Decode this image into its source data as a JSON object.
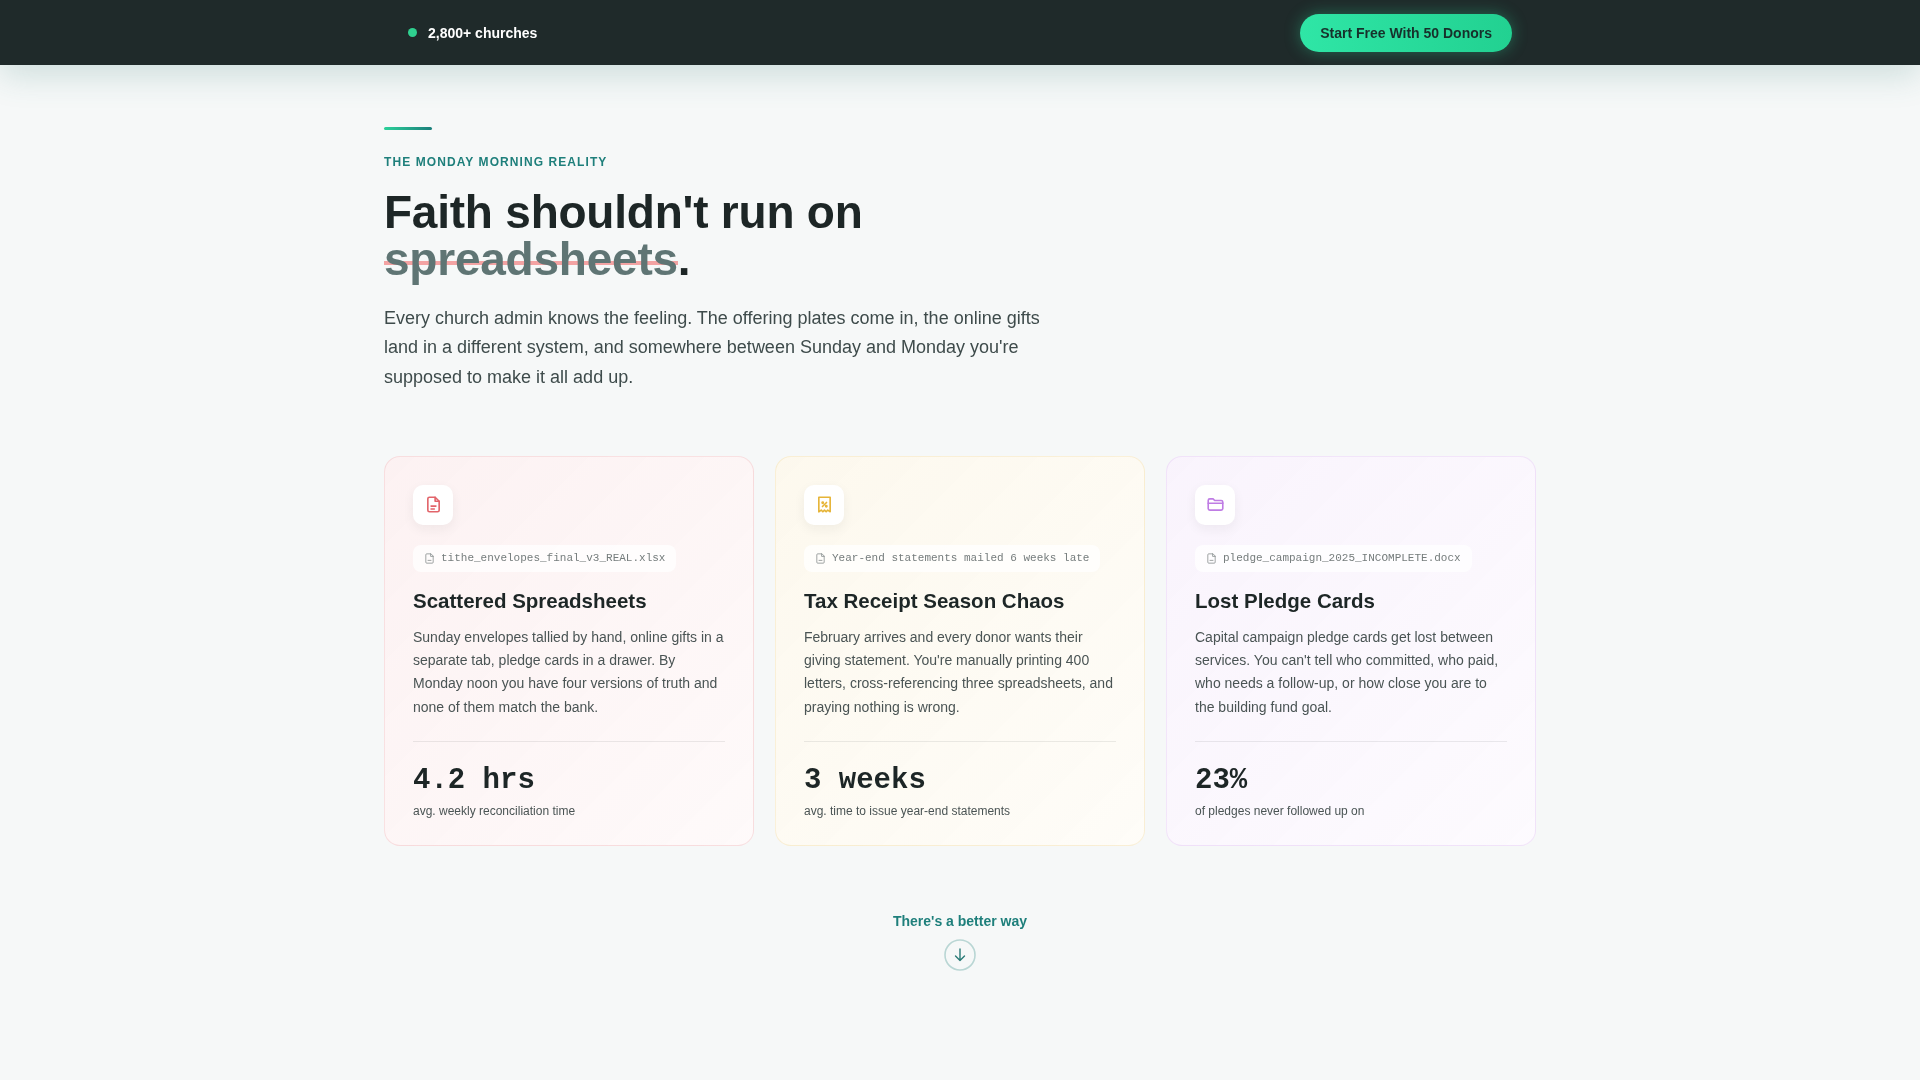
{
  "nav": {
    "status": "2,800+ churches",
    "cta": "Start Free With 50 Donors"
  },
  "hero": {
    "eyebrow": "THE MONDAY MORNING REALITY",
    "headline": [
      {
        "text": "Faith shouldn't run on ",
        "struck": false
      },
      {
        "text": "spreadsheets",
        "struck": true
      },
      {
        "text": ".",
        "struck": false
      }
    ],
    "body": "Every church admin knows the feeling. The offering plates come in, the online gifts land in a different system, and somewhere between Sunday and Monday you're supposed to make it all add up."
  },
  "cards": [
    {
      "kind": "document",
      "color": "#e2646a",
      "file": "tithe_envelopes_final_v3_REAL.xlsx",
      "title": "Scattered Spreadsheets",
      "description": "Sunday envelopes tallied by hand, online gifts in a separate tab, pledge cards in a drawer. By Monday noon you have four versions of truth and none of them match the bank.",
      "stat": "4.2 hrs",
      "stat_label": "avg. weekly reconciliation time"
    },
    {
      "kind": "receipt",
      "color": "#e6b437",
      "file": "Year-end statements mailed 6 weeks late",
      "title": "Tax Receipt Season Chaos",
      "description": "February arrives and every donor wants their giving statement. You're manually printing 400 letters, cross-referencing three spreadsheets, and praying nothing is wrong.",
      "stat": "3 weeks",
      "stat_label": "avg. time to issue year-end statements"
    },
    {
      "kind": "folder",
      "color": "#bf7ce4",
      "file": "pledge_campaign_2025_INCOMPLETE.docx",
      "title": "Lost Pledge Cards",
      "description": "Capital campaign pledge cards get lost between services. You can't tell who committed, who paid, who needs a follow-up, or how close you are to the building fund goal.",
      "stat": "23%",
      "stat_label": "of pledges never followed up on"
    }
  ],
  "next": {
    "label": "There's a better way"
  }
}
